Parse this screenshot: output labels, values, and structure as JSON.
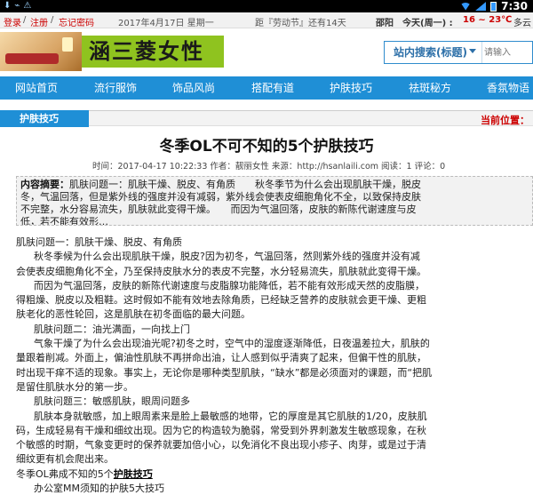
{
  "statusbar": {
    "time": "7:30"
  },
  "topbar": {
    "login": "登录",
    "sep1": "/",
    "register": "注册",
    "sep2": "/",
    "forgot": "忘记密码",
    "date": "2017年4月17日 星期一",
    "countdown": "距『劳动节』还有14天",
    "city": "邵阳",
    "today": "今天(周一) :",
    "temp": "16 ~ 23℃",
    "weather": "多云"
  },
  "header": {
    "logo_text": "涵三菱女性",
    "search_select": "站内搜索(标题)",
    "search_placeholder": "请输入"
  },
  "nav": {
    "items": [
      "网站首页",
      "流行服饰",
      "饰品风尚",
      "搭配有道",
      "护肤技巧",
      "祛斑秘方",
      "香氛物语"
    ]
  },
  "breadcrumb": {
    "section": "护肤技巧",
    "here": "当前位置："
  },
  "article": {
    "title": "冬季OL不可不知的5个护肤技巧",
    "meta": "时间：2017-04-17 10:22:33  作者：靓丽女性  来源：http://hsanlaili.com  阅读：1  评论：0",
    "summary_label": "内容摘要：",
    "summary_l1": "肌肤问题一：肌肤干燥、脱皮、有角质　　秋冬季节为什么会出现肌肤干燥，脱皮",
    "summary_l2": "冬，气温回落，但是紫外线的强度并没有减弱，紫外线会使表皮细胞角化不全，以致保持皮肤",
    "summary_l3": "不完整，水分容易流失，肌肤就此变得干燥。　　而因为气温回落，皮肤的新陈代谢速度与皮",
    "summary_l4": "低，若不能有效形…",
    "lines": [
      "肌肤问题一：肌肤干燥、脱皮、有角质",
      "秋冬季候为什么会出现肌肤干燥，脱皮?因为初冬，气温回落，然则紫外线的强度并没有减",
      "会使表皮细胞角化不全，乃至保持皮肤水分的表皮不完整，水分轻易流失，肌肤就此变得干燥。",
      "而因为气温回落，皮肤的新陈代谢速度与皮脂腺功能降低，若不能有效形成天然的皮脂膜，",
      "得粗燥、脱皮以及粗鞋。这时假如不能有效地去除角质，已经缺乏营养的皮肤就会更干燥、更粗",
      "肤老化的恶性轮回，这是肌肤在初冬面临的最大问题。",
      "肌肤问题二：油光满面，一向找上门",
      "气象干燥了为什么会出现油光呢?初冬之时，空气中的湿度逐渐降低，日夜温差拉大，肌肤的",
      "量跟着削减。外面上，偏油性肌肤不再拼命出油，让人感到似乎清爽了起来，但偏干性的肌肤，",
      "时出现干痒不适的现象。事实上，无论你是哪种类型肌肤，“缺水”都是必须面对的课题，而“把肌",
      "是留住肌肤水分的第一步。",
      "肌肤问题三：敏感肌肤，眼周问题多",
      "肌肤本身就敏感，加上眼周素来是脸上最敏感的地带，它的厚度是其它肌肤的1/20，皮肤肌",
      "码，生成轻易有干燥和细纹出现。因为它的构造较为脆弱，常受到外界刺激发生敏感现象，在秋",
      "个敏感的时期，气象变更时的保养就要加倍小心，以免消化不良出现小疹子、肉芽，或是过于清",
      "细纹更有机会爬出来。"
    ],
    "footer_prefix": "冬季OL弗成不知的5个",
    "footer_link": "护肤技巧",
    "footer_sub": "办公室MM须知的护肤5大技巧"
  }
}
